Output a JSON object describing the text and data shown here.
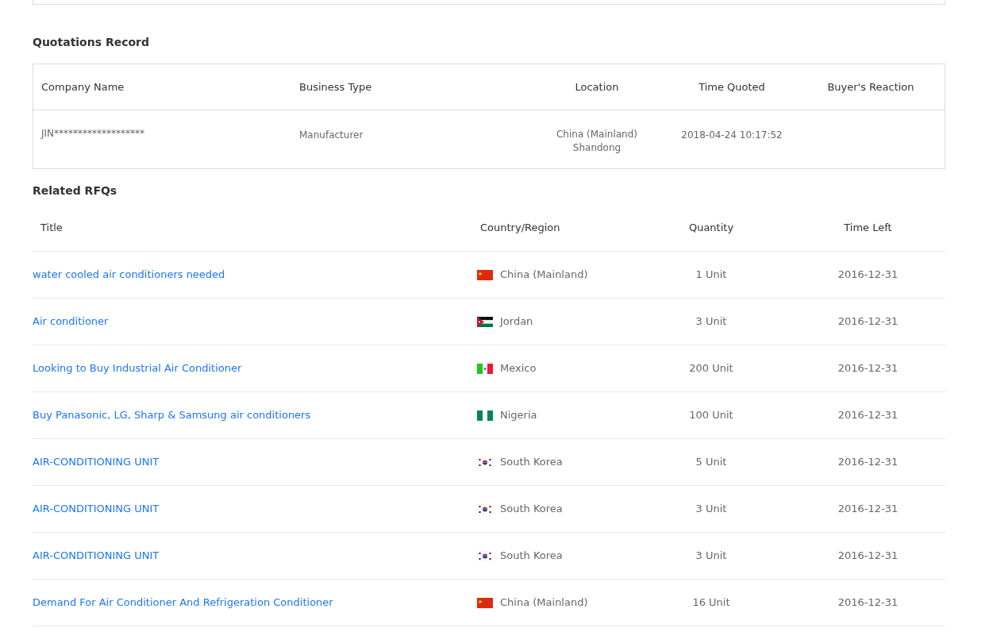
{
  "quotations": {
    "title": "Quotations Record",
    "columns": [
      "Company Name",
      "Business Type",
      "Location",
      "Time Quoted",
      "Buyer's Reaction"
    ],
    "rows": [
      {
        "company": "JIN*******************",
        "business_type": "Manufacturer",
        "location": [
          "China (Mainland)",
          "Shandong"
        ],
        "time_quoted": "2018-04-24 10:17:52"
      }
    ]
  },
  "related_rfqs": {
    "title": "Related RFQs",
    "columns": [
      "Title",
      "Country/Region",
      "Quantity",
      "Time Left"
    ],
    "rows": [
      {
        "title": "water cooled air conditioners needed",
        "kind": "cn",
        "country": "China (Mainland)",
        "quantity": "1 Unit",
        "time_left": "2016-12-31"
      },
      {
        "title": "Air conditioner",
        "kind": "jo",
        "country": "Jordan",
        "quantity": "3 Unit",
        "time_left": "2016-12-31"
      },
      {
        "title": "Looking to Buy Industrial Air Conditioner",
        "kind": "mx",
        "country": "Mexico",
        "quantity": "200 Unit",
        "time_left": "2016-12-31"
      },
      {
        "title": "Buy Panasonic, LG, Sharp & Samsung air conditioners",
        "kind": "ng",
        "country": "Nigeria",
        "quantity": "100 Unit",
        "time_left": "2016-12-31"
      },
      {
        "title": "AIR-CONDITIONING UNIT",
        "kind": "kr",
        "country": "South Korea",
        "quantity": "5 Unit",
        "time_left": "2016-12-31"
      },
      {
        "title": "AIR-CONDITIONING UNIT",
        "kind": "kr",
        "country": "South Korea",
        "quantity": "3 Unit",
        "time_left": "2016-12-31"
      },
      {
        "title": "AIR-CONDITIONING UNIT",
        "kind": "kr",
        "country": "South Korea",
        "quantity": "3 Unit",
        "time_left": "2016-12-31"
      },
      {
        "title": "Demand For Air Conditioner And Refrigeration Conditioner",
        "kind": "cn",
        "country": "China (Mainland)",
        "quantity": "16 Unit",
        "time_left": "2016-12-31"
      }
    ]
  }
}
